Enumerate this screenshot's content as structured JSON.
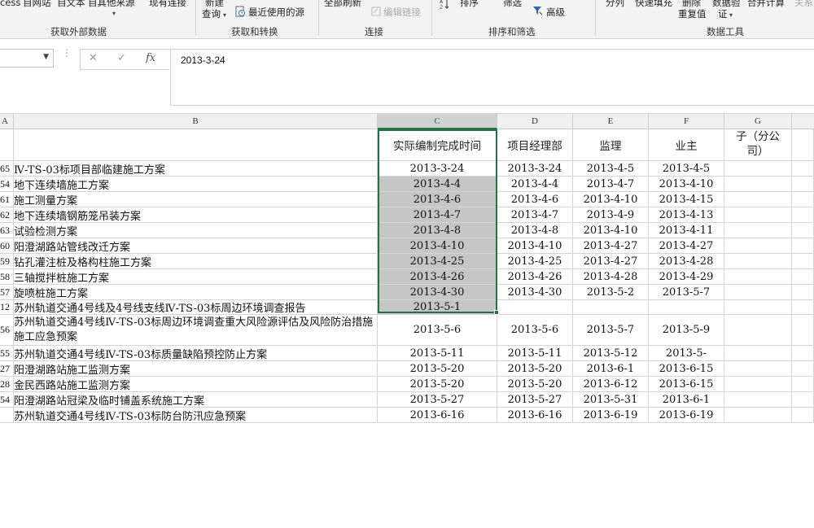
{
  "ribbon": {
    "access_btn": "cess",
    "web_btn": "自网站",
    "text_btn": "自文本",
    "other_btn": "自其他来源",
    "existing_btn": "现有连接",
    "new_query": "新建",
    "new_query_sub": "查询",
    "recent_sources": "最近使用的源",
    "refresh_all": "全部刷新",
    "edit_links": "编辑链接",
    "sort": "排序",
    "filter": "筛选",
    "advanced": "高级",
    "split": "分列",
    "flash_fill": "快速填充",
    "remove_dup_1": "删除",
    "remove_dup_2": "重复值",
    "validation_1": "数据验",
    "validation_2": "证",
    "consolidate": "合并计算",
    "relations": "关系",
    "group_external": "获取外部数据",
    "group_transform": "获取和转换",
    "group_connections": "连接",
    "group_sort_filter": "排序和筛选",
    "group_tools": "数据工具"
  },
  "formula_bar": {
    "name_box": "",
    "cancel_icon": "✕",
    "enter_icon": "✓",
    "fx": "fx",
    "content": "2013-3-24"
  },
  "columns": [
    "A",
    "B",
    "C",
    "D",
    "E",
    "F",
    "G"
  ],
  "header_row": {
    "a": "",
    "b": "",
    "c": "实际编制完成时间",
    "d": "项目经理部",
    "e": "监理",
    "f": "业主",
    "g": "子（分公司）"
  },
  "rows": [
    {
      "a": "65",
      "b": "Ⅳ-TS-03标项目部临建施工方案",
      "c": "2013-3-24",
      "d": "2013-3-24",
      "e": "2013-4-5",
      "f": "2013-4-5",
      "g": ""
    },
    {
      "a": "54",
      "b": "地下连续墙施工方案",
      "c": "2013-4-4",
      "d": "2013-4-4",
      "e": "2013-4-7",
      "f": "2013-4-10",
      "g": ""
    },
    {
      "a": "61",
      "b": "施工测量方案",
      "c": "2013-4-6",
      "d": "2013-4-6",
      "e": "2013-4-10",
      "f": "2013-4-15",
      "g": ""
    },
    {
      "a": "62",
      "b": "地下连续墙钢筋笼吊装方案",
      "c": "2013-4-7",
      "d": "2013-4-7",
      "e": "2013-4-9",
      "f": "2013-4-13",
      "g": ""
    },
    {
      "a": "63",
      "b": "试验检测方案",
      "c": "2013-4-8",
      "d": "2013-4-8",
      "e": "2013-4-10",
      "f": "2013-4-11",
      "g": ""
    },
    {
      "a": "60",
      "b": "阳澄湖路站管线改迁方案",
      "c": "2013-4-10",
      "d": "2013-4-10",
      "e": "2013-4-27",
      "f": "2013-4-27",
      "g": ""
    },
    {
      "a": "59",
      "b": "钻孔灌注桩及格构柱施工方案",
      "c": "2013-4-25",
      "d": "2013-4-25",
      "e": "2013-4-27",
      "f": "2013-4-28",
      "g": ""
    },
    {
      "a": "58",
      "b": "三轴搅拌桩施工方案",
      "c": "2013-4-26",
      "d": "2013-4-26",
      "e": "2013-4-28",
      "f": "2013-4-29",
      "g": ""
    },
    {
      "a": "57",
      "b": "旋喷桩施工方案",
      "c": "2013-4-30",
      "d": "2013-4-30",
      "e": "2013-5-2",
      "f": "2013-5-7",
      "g": ""
    },
    {
      "a": "12",
      "b": "苏州轨道交通4号线及4号线支线Ⅳ-TS-03标周边环境调查报告",
      "c": "2013-5-1",
      "d": "",
      "e": "",
      "f": "",
      "g": ""
    },
    {
      "a": "56",
      "b": "苏州轨道交通4号线Ⅳ-TS-03标周边环境调查重大风险源评估及风险防治措施施工应急预案",
      "c": "2013-5-6",
      "d": "2013-5-6",
      "e": "2013-5-7",
      "f": "2013-5-9",
      "g": ""
    },
    {
      "a": "55",
      "b": "苏州轨道交通4号线Ⅳ-TS-03标质量缺陷预控防止方案",
      "c": "2013-5-11",
      "d": "2013-5-11",
      "e": "2013-5-12",
      "f": "2013-5-",
      "g": ""
    },
    {
      "a": "27",
      "b": "阳澄湖路站施工监测方案",
      "c": "2013-5-20",
      "d": "2013-5-20",
      "e": "2013-6-1",
      "f": "2013-6-15",
      "g": ""
    },
    {
      "a": "28",
      "b": "金民西路站施工监测方案",
      "c": "2013-5-20",
      "d": "2013-5-20",
      "e": "2013-6-12",
      "f": "2013-6-15",
      "g": ""
    },
    {
      "a": "54",
      "b": "阳澄湖路站冠梁及临时铺盖系统施工方案",
      "c": "2013-5-27",
      "d": "2013-5-27",
      "e": "2013-5-31",
      "f": "2013-6-1",
      "g": ""
    },
    {
      "a": "",
      "b": "苏州轨道交通4号线Ⅳ-TS-03标防台防汛应急预案",
      "c": "2013-6-16",
      "d": "2013-6-16",
      "e": "2013-6-19",
      "f": "2013-6-19",
      "g": ""
    }
  ],
  "colors": {
    "selection": "#217346",
    "selected_fill": "#c6c6c6"
  }
}
